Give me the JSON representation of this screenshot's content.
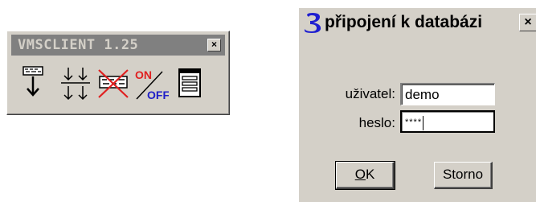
{
  "toolbar_window": {
    "title": "VMSCLIENT 1.25",
    "close_glyph": "×",
    "tools": [
      {
        "icon": "download-arrow-icon"
      },
      {
        "icon": "split-arrows-icon"
      },
      {
        "icon": "disabled-transfer-icon"
      },
      {
        "icon": "on-off-toggle-icon"
      },
      {
        "icon": "window-list-icon"
      }
    ],
    "on_label": "ON",
    "off_label": "OFF"
  },
  "login_dialog": {
    "title": "připojení k databázi",
    "close_glyph": "×",
    "user_label": "uživatel:",
    "user_value": "demo",
    "password_label": "heslo:",
    "password_value": "****",
    "ok_label_first": "O",
    "ok_label_rest": "K",
    "cancel_label": "Storno",
    "colors": {
      "app_icon": "#1f1fd0",
      "face": "#d4d0c8"
    }
  }
}
